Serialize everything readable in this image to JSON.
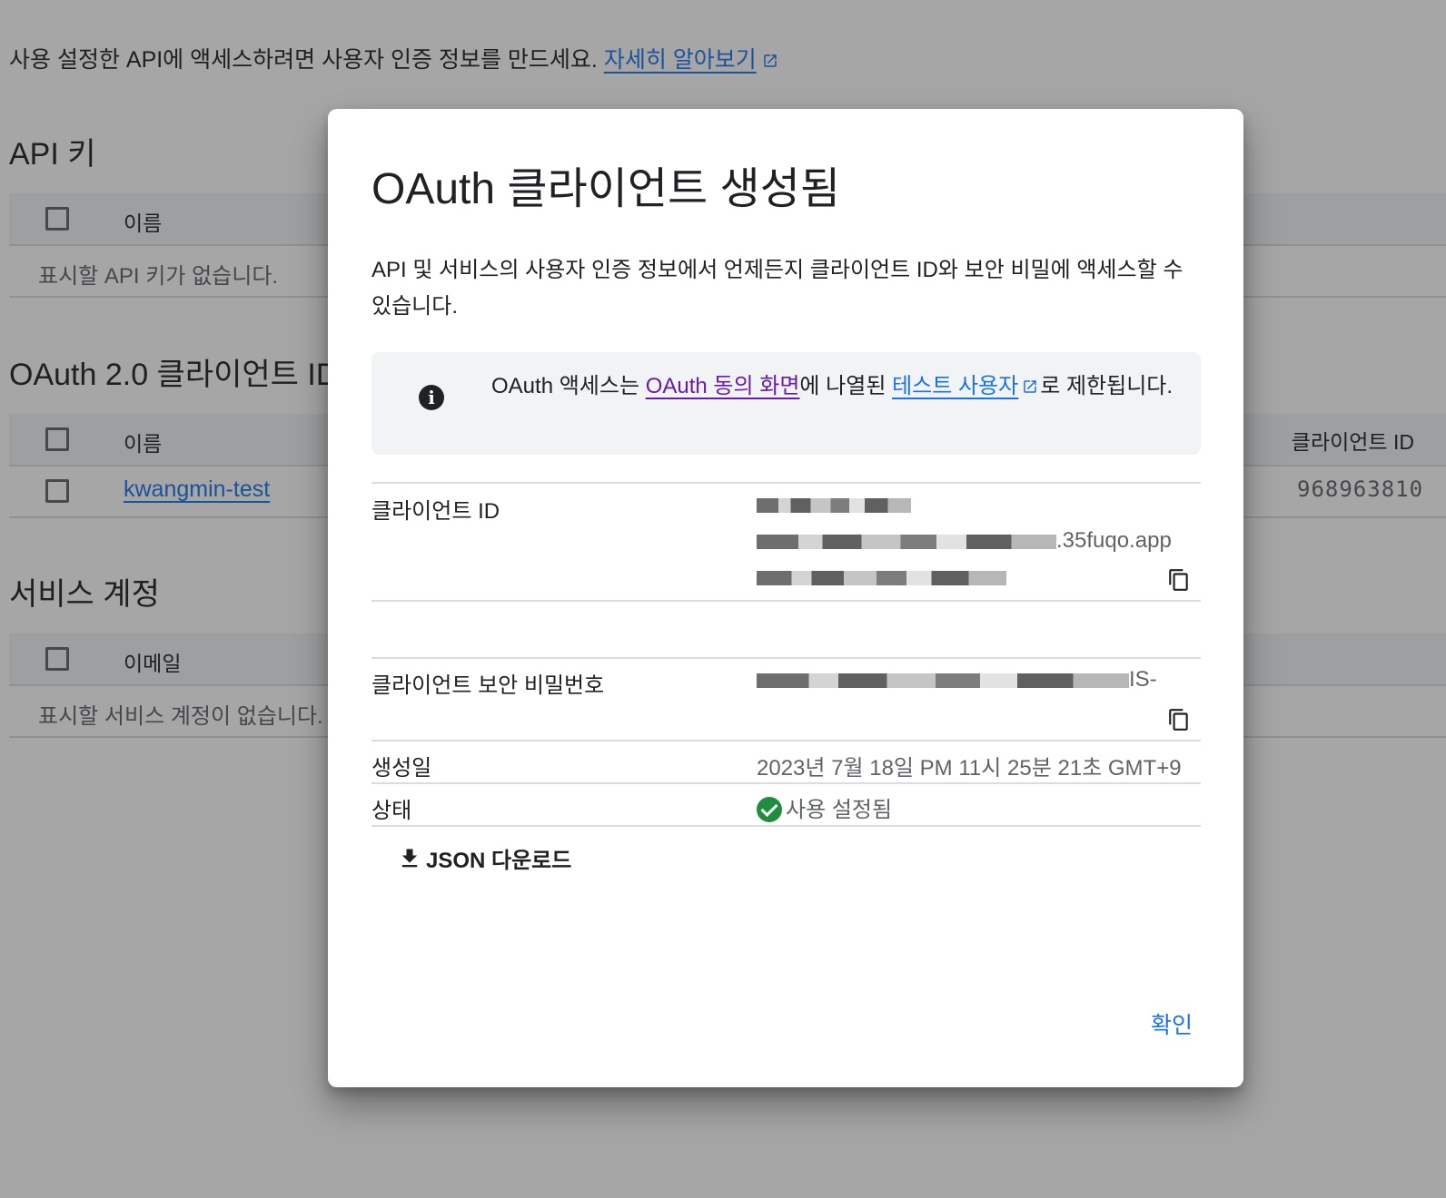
{
  "background": {
    "intro_text": "사용 설정한 API에 액세스하려면 사용자 인증 정보를 만드세요. ",
    "intro_link": "자세히 알아보기",
    "api_keys": {
      "title": "API 키",
      "column_name": "이름",
      "empty": "표시할 API 키가 없습니다."
    },
    "oauth_clients": {
      "title": "OAuth 2.0 클라이언트 ID",
      "column_name": "이름",
      "column_client_id": "클라이언트 ID",
      "rows": [
        {
          "name": "kwangmin-test",
          "client_id": "968963810"
        }
      ]
    },
    "service_accounts": {
      "title": "서비스 계정",
      "column_email": "이메일",
      "empty": "표시할 서비스 계정이 없습니다."
    }
  },
  "dialog": {
    "title": "OAuth 클라이언트 생성됨",
    "description": "API 및 서비스의 사용자 인증 정보에서 언제든지 클라이언트 ID와 보안 비밀에 액세스할 수 있습니다.",
    "notice": {
      "icon": "info-icon",
      "text_before": "OAuth 액세스는 ",
      "link1": "OAuth 동의 화면",
      "text_middle": "에 나열된 ",
      "link2": "테스트 사용자",
      "text_after": "로 제한됩니다."
    },
    "client_id_label": "클라이언트 ID",
    "client_id_visible_fragment": ".35fuqo.app",
    "client_secret_label": "클라이언트 보안 비밀번호",
    "client_secret_visible_fragment": "IS-",
    "created_label": "생성일",
    "created_value": "2023년 7월 18일 PM 11시 25분 21초 GMT+9",
    "status_label": "상태",
    "status_value": "사용 설정됨",
    "download_label": "JSON 다운로드",
    "confirm_label": "확인"
  },
  "colors": {
    "link": "#1a73e8",
    "visited_link": "#681da8",
    "status_ok": "#1e8e3e"
  }
}
